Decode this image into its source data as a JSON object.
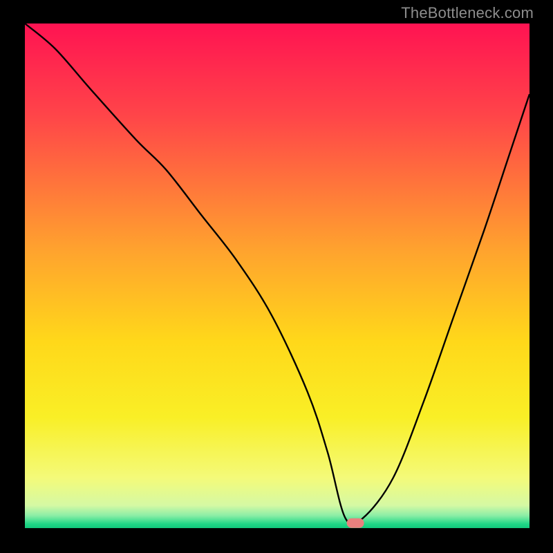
{
  "watermark": "TheBottleneck.com",
  "chart_data": {
    "type": "line",
    "title": "",
    "xlabel": "",
    "ylabel": "",
    "xlim": [
      0,
      100
    ],
    "ylim": [
      0,
      100
    ],
    "grid": false,
    "legend": false,
    "background": {
      "kind": "heat-gradient",
      "stops": [
        {
          "pos": 0.0,
          "color": "#ff1352"
        },
        {
          "pos": 0.18,
          "color": "#ff4449"
        },
        {
          "pos": 0.45,
          "color": "#ffa32e"
        },
        {
          "pos": 0.63,
          "color": "#ffd81a"
        },
        {
          "pos": 0.78,
          "color": "#f9ef26"
        },
        {
          "pos": 0.9,
          "color": "#f4fa79"
        },
        {
          "pos": 0.955,
          "color": "#d5f9a4"
        },
        {
          "pos": 0.975,
          "color": "#8ceea6"
        },
        {
          "pos": 0.992,
          "color": "#1fd786"
        },
        {
          "pos": 1.0,
          "color": "#13c77b"
        }
      ]
    },
    "series": [
      {
        "name": "bottleneck-curve",
        "color": "#000000",
        "x": [
          0,
          6,
          13,
          22,
          28,
          35,
          42,
          49,
          56,
          60,
          63.5,
          67,
          73,
          79,
          85,
          91,
          96,
          100
        ],
        "values": [
          100,
          95,
          87,
          77,
          71,
          62,
          53,
          42,
          27,
          15,
          2,
          2,
          10,
          25,
          42,
          59,
          74,
          86
        ]
      }
    ],
    "marker": {
      "name": "optimal-point",
      "x": 65.5,
      "y": 1,
      "width_pct": 3.4,
      "height_pct": 2.0,
      "color": "#ea807e",
      "shape": "pill"
    }
  }
}
